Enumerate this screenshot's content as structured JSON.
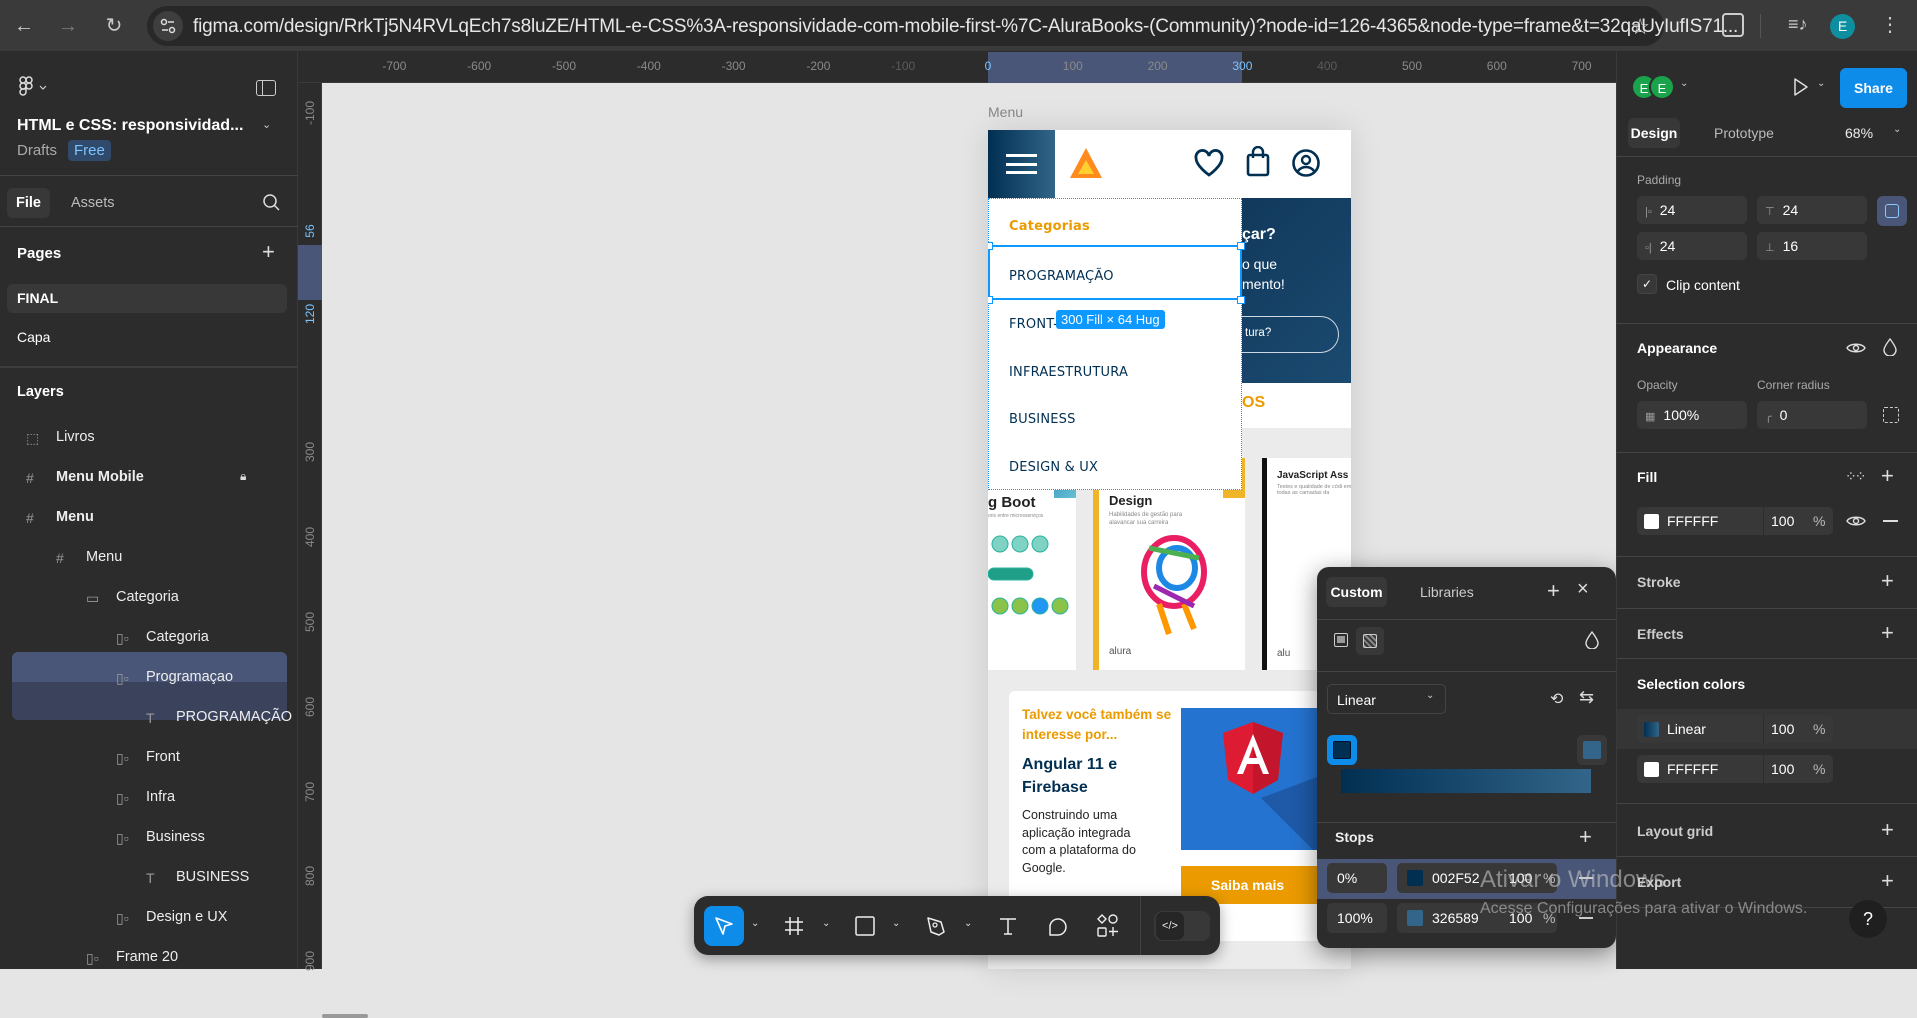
{
  "browser": {
    "url": "figma.com/design/RrkTj5N4RVLqEch7s8luZE/HTML-e-CSS%3A-responsividade-com-mobile-first-%7C-AluraBooks-(Community)?node-id=126-4365&node-type=frame&t=32qaUyIufIS71...",
    "profile_initial": "E"
  },
  "left_panel": {
    "file_title": "HTML e CSS: responsividad...",
    "location": "Drafts",
    "plan_badge": "Free",
    "tabs": [
      "File",
      "Assets"
    ],
    "pages_label": "Pages",
    "pages": [
      "FINAL",
      "Capa"
    ],
    "layers_label": "Layers",
    "layers": [
      {
        "name": "Livros",
        "icon": "section-icon",
        "depth": 0
      },
      {
        "name": "Menu Mobile",
        "icon": "frame-icon",
        "depth": 0,
        "locked": true
      },
      {
        "name": "Menu",
        "icon": "frame-icon",
        "depth": 0
      },
      {
        "name": "Menu",
        "icon": "frame-icon",
        "depth": 1
      },
      {
        "name": "Categoria",
        "icon": "vertical-auto-layout-icon",
        "depth": 2
      },
      {
        "name": "Categoria",
        "icon": "horizontal-auto-layout-icon",
        "depth": 3
      },
      {
        "name": "Programaçao",
        "icon": "horizontal-auto-layout-icon",
        "depth": 3,
        "selected": true
      },
      {
        "name": "PROGRAMAÇÃO",
        "icon": "text-icon",
        "depth": 4,
        "selected_child": true
      },
      {
        "name": "Front",
        "icon": "horizontal-auto-layout-icon",
        "depth": 3
      },
      {
        "name": "Infra",
        "icon": "horizontal-auto-layout-icon",
        "depth": 3
      },
      {
        "name": "Business",
        "icon": "horizontal-auto-layout-icon",
        "depth": 3
      },
      {
        "name": "BUSINESS",
        "icon": "text-icon",
        "depth": 4
      },
      {
        "name": "Design e UX",
        "icon": "horizontal-auto-layout-icon",
        "depth": 3
      },
      {
        "name": "Frame 20",
        "icon": "horizontal-auto-layout-icon",
        "depth": 2
      }
    ]
  },
  "rulers": {
    "top": [
      "-700",
      "-600",
      "-500",
      "-400",
      "-300",
      "-200",
      "-100",
      "0",
      "100",
      "200",
      "300",
      "400",
      "500",
      "600",
      "700"
    ],
    "top_highlight": [
      "0",
      "300"
    ],
    "left": [
      "-100",
      "56",
      "120",
      "300",
      "400",
      "500",
      "600",
      "700",
      "800",
      "900"
    ],
    "left_highlight": [
      "56",
      "120"
    ]
  },
  "canvas": {
    "frame_label": "Menu",
    "size_badge": "300 Fill × 64 Hug",
    "menu": {
      "title": "Categorias",
      "items": [
        "PROGRAMAÇÃO",
        "FRONT-",
        "INFRAESTRUTURA",
        "BUSINESS",
        "DESIGN & UX"
      ]
    },
    "hero": {
      "line1": "çar?",
      "line2": "o que",
      "line3": "mento!",
      "button": "tura?"
    },
    "section_title_tail": "OS",
    "books": [
      {
        "title": "g Boot",
        "subtitle": "ons entre microsserviços"
      },
      {
        "title": "Design",
        "subtitle": "Habilidades de gestão para alavancar sua carreira",
        "publisher": "alura"
      },
      {
        "title": "JavaScript Ass",
        "subtitle": "Testes e qualidade de códi em todas as camadas da",
        "publisher": "alu"
      }
    ],
    "card": {
      "kicker": "Talvez você também se interesse por...",
      "title": "Angular 11 e Firebase",
      "description": "Construindo uma aplicação integrada com a plataforma do Google.",
      "button": "Saiba mais"
    },
    "colors": {
      "primary": "#002F52",
      "accent": "#EB9B00",
      "selection": "#0D99FF"
    }
  },
  "toolbar": {
    "tools": [
      "move-tool",
      "frame-tool",
      "rectangle-tool",
      "pen-tool",
      "text-tool",
      "comment-tool",
      "actions-tool"
    ],
    "active": "move-tool",
    "dev_mode": "off"
  },
  "right_panel": {
    "avatars": [
      "E",
      "E"
    ],
    "share": "Share",
    "tabs": [
      "Design",
      "Prototype"
    ],
    "zoom": "68%",
    "padding_label": "Padding",
    "padding": {
      "left": "24",
      "top": "24",
      "right": "24",
      "bottom": "16"
    },
    "clip_content": {
      "label": "Clip content",
      "checked": true
    },
    "appearance": {
      "title": "Appearance",
      "opacity_label": "Opacity",
      "opacity": "100%",
      "radius_label": "Corner radius",
      "radius": "0"
    },
    "fill": {
      "title": "Fill",
      "hex": "FFFFFF",
      "opacity": "100",
      "unit": "%"
    },
    "stroke": "Stroke",
    "effects": "Effects",
    "selection_colors": {
      "title": "Selection colors",
      "items": [
        {
          "label": "Linear",
          "opacity": "100",
          "unit": "%"
        },
        {
          "label": "FFFFFF",
          "opacity": "100",
          "unit": "%"
        }
      ]
    },
    "layout_grid": "Layout grid",
    "export": "Export",
    "help": "?"
  },
  "color_picker": {
    "tabs": [
      "Custom",
      "Libraries"
    ],
    "gradient_type": "Linear",
    "stops_label": "Stops",
    "stops": [
      {
        "position": "0%",
        "hex": "002F52",
        "opacity": "100",
        "unit": "%",
        "color": "#002F52"
      },
      {
        "position": "100%",
        "hex": "326589",
        "opacity": "100",
        "unit": "%",
        "color": "#326589"
      }
    ]
  },
  "watermark": {
    "title": "Ativar o Windows",
    "subtitle": "Acesse Configurações para ativar o Windows."
  }
}
